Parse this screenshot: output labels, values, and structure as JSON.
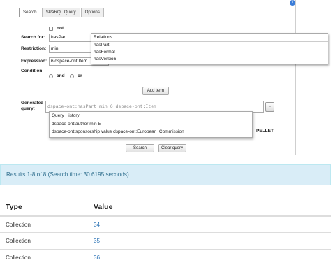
{
  "tabs": [
    {
      "label": "Search",
      "active": true
    },
    {
      "label": "SPARQL Query",
      "active": false
    },
    {
      "label": "Options",
      "active": false
    }
  ],
  "form": {
    "not_label": "not",
    "search_for_label": "Search for:",
    "search_for_value": "hasPart",
    "restriction_label": "Restriction:",
    "restriction_value": "min",
    "expression_label": "Expression:",
    "expression_value": "6 dspace-ont:Item",
    "condition_label": "Condition:",
    "and_label": "and",
    "or_label": "or",
    "add_term_label": "Add term",
    "generated_query_label_1": "Generated",
    "generated_query_label_2": "query:",
    "generated_query_value": "dspace-ont:hasPart min 6 dspace-ont:Item",
    "pellet_label": "PELLET",
    "search_button": "Search",
    "clear_button": "Clear query"
  },
  "relations_dropdown": {
    "header": "Relations",
    "items": [
      "hasPart",
      "hasFormat",
      "hasVersion"
    ]
  },
  "history_dropdown": {
    "header": "Query History",
    "items": [
      "dspace-ont:author min 5",
      "dspace-ont:sponsorship value dspace-ont:European_Commission"
    ]
  },
  "results": {
    "summary": "Results 1-8 of 8 (Search time: 30.6195 seconds)."
  },
  "table": {
    "headers": [
      "Type",
      "Value"
    ],
    "rows": [
      [
        "Collection",
        "34"
      ],
      [
        "Collection",
        "35"
      ],
      [
        "Collection",
        "36"
      ]
    ]
  },
  "colors": {
    "link": "#2a72b5",
    "results_bg": "#d9edf7",
    "results_text": "#31708f",
    "info_icon": "#3b7dd8"
  },
  "icons": {
    "info": "info-icon",
    "dropdown": "chevron-down-icon"
  }
}
